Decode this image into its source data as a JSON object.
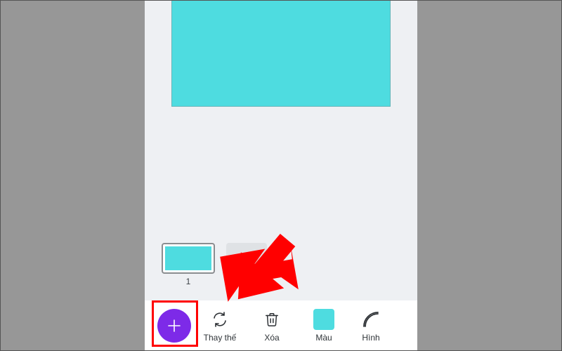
{
  "colors": {
    "canvas_fill": "#4edce0",
    "fab_bg": "#7d2ae8",
    "highlight": "#ff0000"
  },
  "pages": {
    "thumb1_number": "1",
    "add_page_glyph": "+"
  },
  "toolbar": {
    "add_label": "",
    "replace_label": "Thay thế",
    "delete_label": "Xóa",
    "color_label": "Màu",
    "shape_label": "Hình"
  }
}
